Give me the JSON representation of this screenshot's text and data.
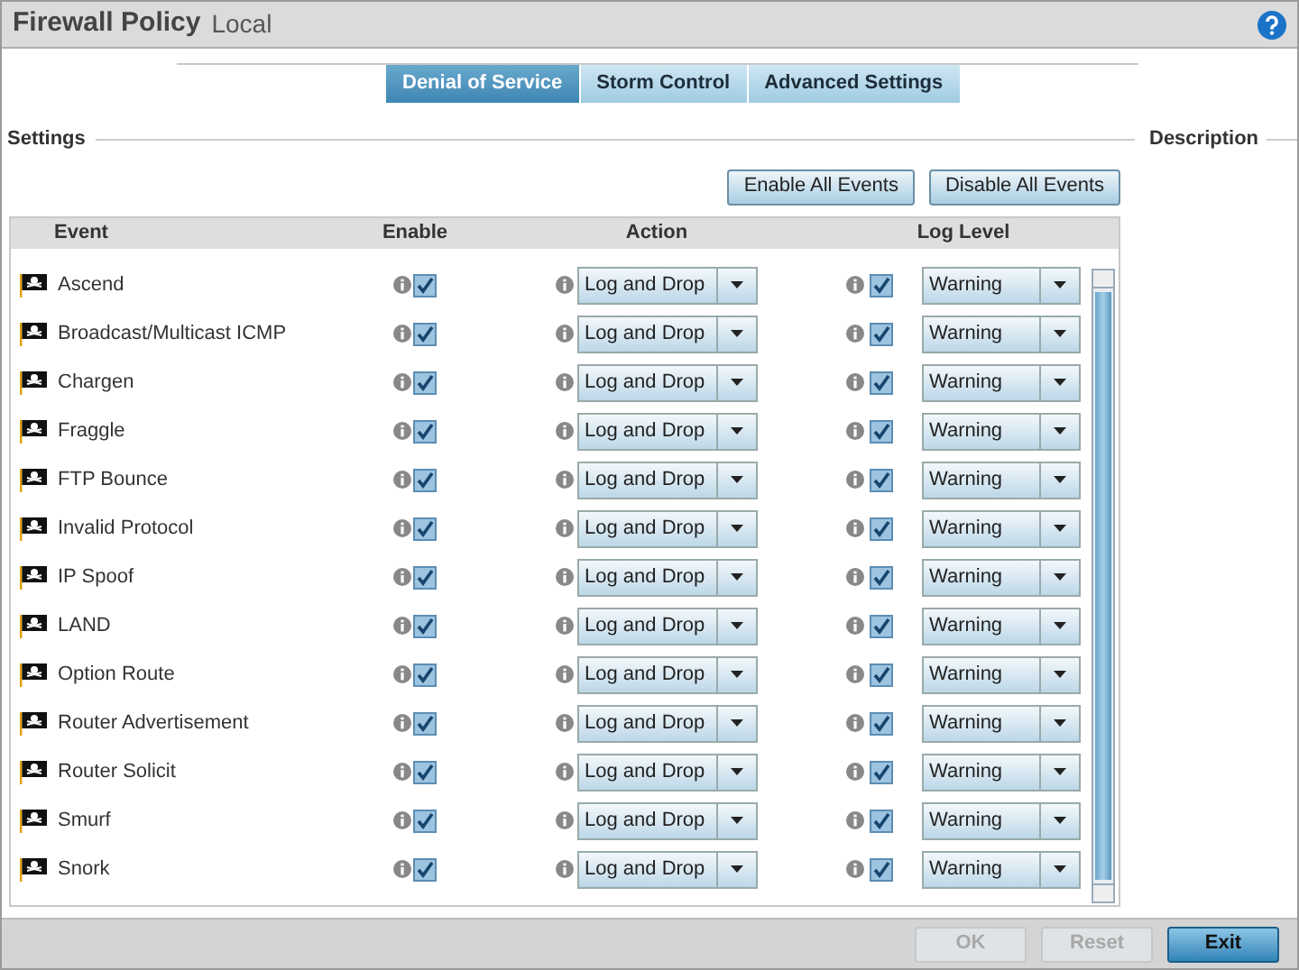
{
  "header": {
    "title": "Firewall Policy",
    "subtitle": "Local"
  },
  "tabs": [
    {
      "label": "Denial of Service",
      "selected": true
    },
    {
      "label": "Storm Control",
      "selected": false
    },
    {
      "label": "Advanced Settings",
      "selected": false
    }
  ],
  "settings_label": "Settings",
  "description_label": "Description",
  "actions": [
    "Enable All Events",
    "Disable All Events"
  ],
  "table": {
    "columns": [
      "Event",
      "Enable",
      "Action",
      "Log Level"
    ],
    "rows": [
      {
        "event": "Ascend",
        "enabled": true,
        "action": "Log and Drop",
        "log_enabled": true,
        "log_level": "Warning"
      },
      {
        "event": "Broadcast/Multicast ICMP",
        "enabled": true,
        "action": "Log and Drop",
        "log_enabled": true,
        "log_level": "Warning"
      },
      {
        "event": "Chargen",
        "enabled": true,
        "action": "Log and Drop",
        "log_enabled": true,
        "log_level": "Warning"
      },
      {
        "event": "Fraggle",
        "enabled": true,
        "action": "Log and Drop",
        "log_enabled": true,
        "log_level": "Warning"
      },
      {
        "event": "FTP Bounce",
        "enabled": true,
        "action": "Log and Drop",
        "log_enabled": true,
        "log_level": "Warning"
      },
      {
        "event": "Invalid Protocol",
        "enabled": true,
        "action": "Log and Drop",
        "log_enabled": true,
        "log_level": "Warning"
      },
      {
        "event": "IP Spoof",
        "enabled": true,
        "action": "Log and Drop",
        "log_enabled": true,
        "log_level": "Warning"
      },
      {
        "event": "LAND",
        "enabled": true,
        "action": "Log and Drop",
        "log_enabled": true,
        "log_level": "Warning"
      },
      {
        "event": "Option Route",
        "enabled": true,
        "action": "Log and Drop",
        "log_enabled": true,
        "log_level": "Warning"
      },
      {
        "event": "Router Advertisement",
        "enabled": true,
        "action": "Log and Drop",
        "log_enabled": true,
        "log_level": "Warning"
      },
      {
        "event": "Router Solicit",
        "enabled": true,
        "action": "Log and Drop",
        "log_enabled": true,
        "log_level": "Warning"
      },
      {
        "event": "Smurf",
        "enabled": true,
        "action": "Log and Drop",
        "log_enabled": true,
        "log_level": "Warning"
      },
      {
        "event": "Snork",
        "enabled": true,
        "action": "Log and Drop",
        "log_enabled": true,
        "log_level": "Warning"
      }
    ]
  },
  "footer_buttons": [
    {
      "label": "OK",
      "disabled": true
    },
    {
      "label": "Reset",
      "disabled": true
    },
    {
      "label": "Exit",
      "disabled": false
    }
  ]
}
